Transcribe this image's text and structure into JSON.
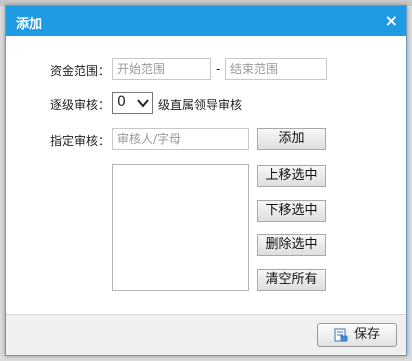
{
  "dialog": {
    "title": "添加",
    "close_glyph": "×"
  },
  "form": {
    "fund_range_label": "资金范围：",
    "range_start_placeholder": "开始范围",
    "range_separator": "-",
    "range_end_placeholder": "结束范围",
    "level_label": "逐级审核：",
    "level_value": "0",
    "level_suffix": "级直属领导审核",
    "reviewer_label": "指定审核：",
    "reviewer_placeholder": "审核人/字母",
    "add_button": "添加",
    "move_up_button": "上移选中",
    "move_down_button": "下移选中",
    "delete_button": "删除选中",
    "clear_button": "清空所有"
  },
  "footer": {
    "save_button": "保存"
  }
}
